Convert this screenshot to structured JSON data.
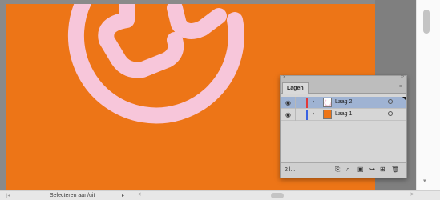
{
  "canvas": {
    "artboard_color": "#ed7517",
    "shape_color": "#f7c6da",
    "pasteboard_color": "#8a8a8a"
  },
  "layers_panel": {
    "close_icon": "×",
    "collapse_icon": "››",
    "tab_label": "Lagen",
    "menu_icon": "≡",
    "layers": [
      {
        "name": "Laag 2",
        "selected": true,
        "color": "#e23a3a"
      },
      {
        "name": "Laag 1",
        "selected": false,
        "color": "#3a63e2"
      }
    ],
    "count_label": "2 l...",
    "eye_icon": "◉",
    "expand_icon": "›"
  },
  "status_bar": {
    "nav_icon": "|◂",
    "text": "Selecteren aan/uit",
    "arrow_icon": "▸",
    "scroll_left": "<",
    "scroll_right": ">"
  },
  "vertical_scroll": {
    "down_icon": "▾"
  }
}
